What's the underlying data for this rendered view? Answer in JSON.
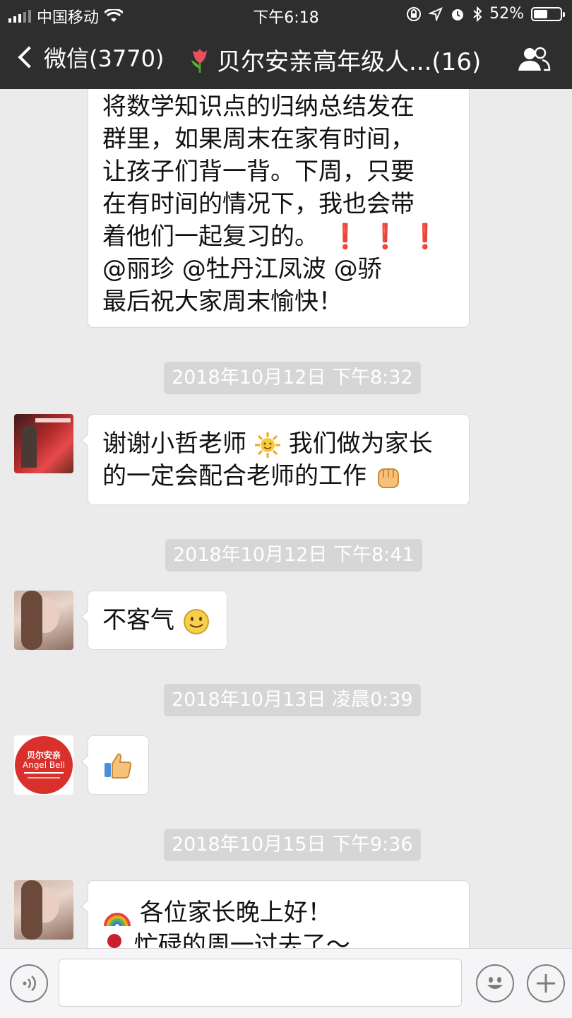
{
  "status": {
    "carrier": "中国移动",
    "time": "下午6:18",
    "battery_percent": "52%",
    "battery_level": 0.52
  },
  "nav": {
    "back_label": "微信(3770)",
    "title": "贝尔安亲高年级人...(16)",
    "title_icon": "tulip-emoji"
  },
  "messages": {
    "m1": {
      "lines": [
        "将数学知识点的归纳总结发在",
        "群里，如果周末在家有时间，",
        "让孩子们背一背。下周，只要",
        "在有时间的情况下，我也会带",
        "着他们一起复习的。",
        "@丽珍 @牡丹江凤波 @骄",
        "最后祝大家周末愉快！"
      ],
      "exclaim": "❗️❗️❗️"
    },
    "t1": "2018年10月12日 下午8:32",
    "m2": {
      "part1": "谢谢小哲老师",
      "part2": "我们做为家长",
      "line2": "的一定会配合老师的工作"
    },
    "t2": "2018年10月12日 下午8:41",
    "m3": {
      "text": "不客气"
    },
    "t3": "2018年10月13日 凌晨0:39",
    "t4": "2018年10月15日 下午9:36",
    "m5": {
      "line1": "各位家长晚上好！",
      "line2": "忙碌的周一过去了～"
    }
  },
  "avatars": {
    "logo_brand": "贝尔安亲",
    "logo_en": "Angel Bell"
  },
  "input": {
    "placeholder": ""
  }
}
